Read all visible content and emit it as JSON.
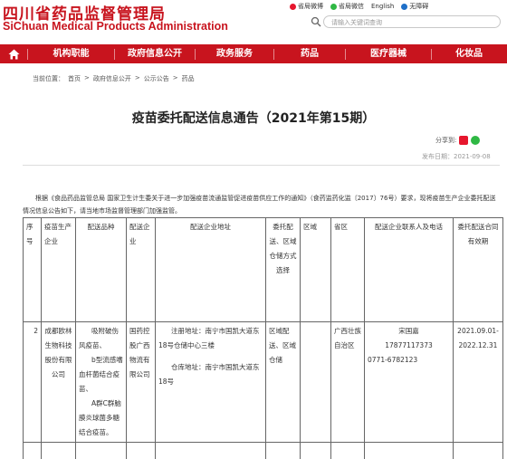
{
  "header": {
    "logo_cn": "四川省药品监督管理局",
    "logo_en": "SiChuan Medical Products Administration",
    "top_links": [
      "省局微博",
      "省局微信",
      "English",
      "无障碍"
    ],
    "search_placeholder": "请输入关键词查询"
  },
  "nav": {
    "items": [
      "机构职能",
      "政府信息公开",
      "政务服务",
      "药品",
      "医疗器械",
      "化妆品"
    ]
  },
  "breadcrumb": {
    "prefix": "当前位置：",
    "items": [
      "首页",
      "政府信息公开",
      "公示公告",
      "药品"
    ],
    "separator": ">"
  },
  "article": {
    "title": "疫苗委托配送信息通告（2021年第15期）",
    "share_label": "分享到:",
    "date_label": "发布日期：",
    "date": "2021-09-08",
    "intro": "根据《食品药品监管总局 国家卫生计生委关于进一步加强疫苗流通监管促进疫苗供应工作的通知》（食药监药化监〔2017〕76号）要求，现将疫苗生产企业委托配送情况信息公告如下，请当地市场监督管理部门加强监管。"
  },
  "table": {
    "headers": [
      "序号",
      "疫苗生产企业",
      "配送品种",
      "配送企业",
      "配送企业地址",
      "委托配送、区域仓储方式选择",
      "区域",
      "省区",
      "配送企业联系人及电话",
      "委托配送合同有效期"
    ],
    "row1": {
      "no": "2",
      "company": "成都欧林生物科技股份有限公司",
      "products": [
        "吸附破伤风疫苗、",
        "b型流感嗜血杆菌结合疫苗、",
        "A群C群脑膜炎球菌多糖结合疫苗。"
      ],
      "distributor": "国药控股广西物流有限公司",
      "address_reg": "注册地址：南宁市国凯大道东18号仓储中心三楼",
      "address_wh": "仓库地址：南宁市国凯大道东18号",
      "mode": "区域配送、区域仓储",
      "region": "",
      "province": "广西壮族自治区",
      "contact_name": "宋国嘉",
      "contact_mobile": "17877117373",
      "contact_phone": "0771-6782123",
      "validity": "2021.09.01-2022.12.31"
    }
  },
  "colors": {
    "brand_red": "#c8141e"
  }
}
